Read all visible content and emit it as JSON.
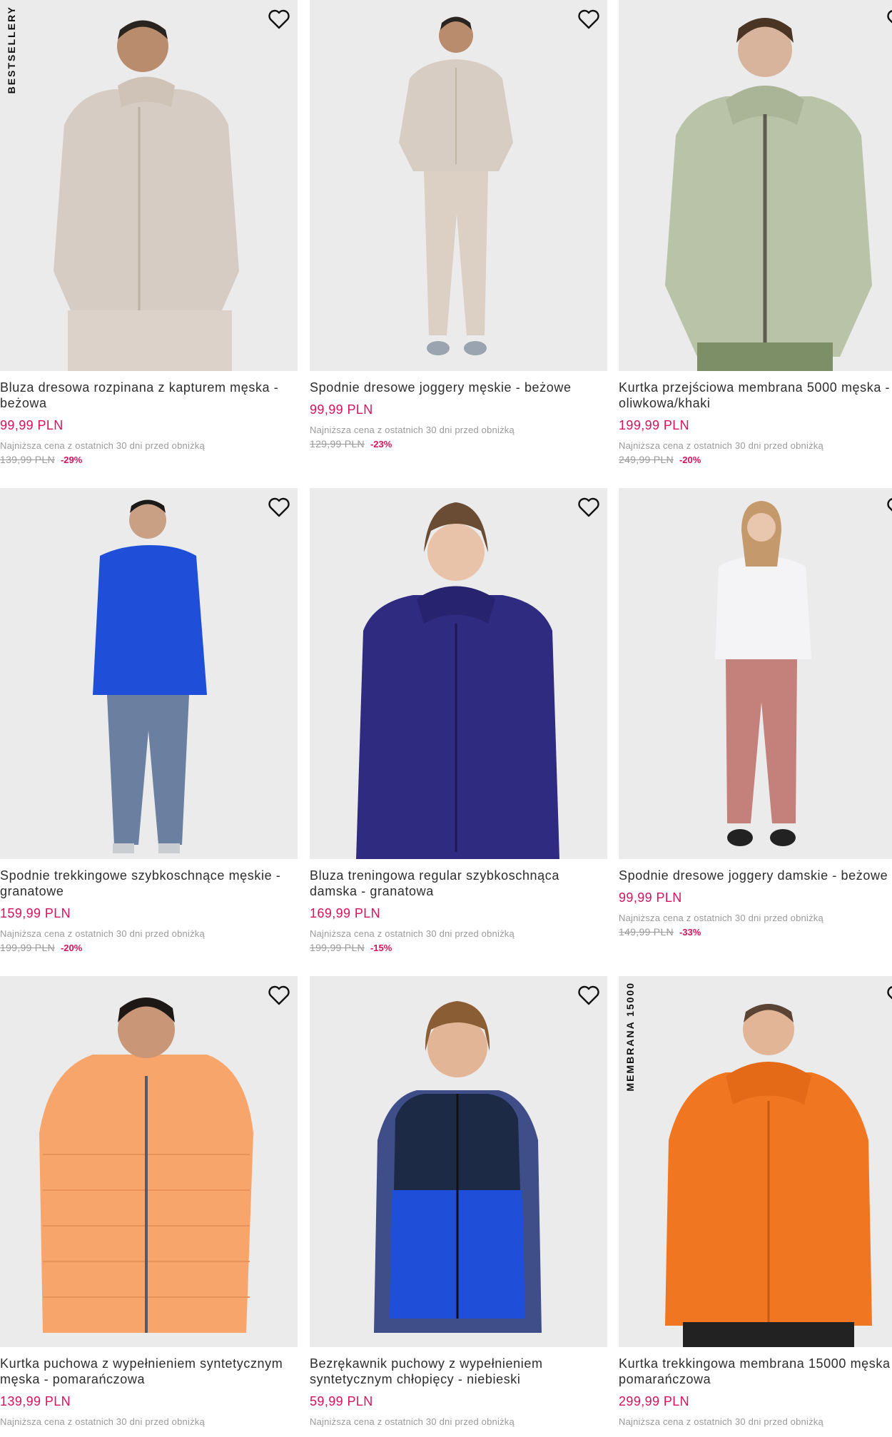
{
  "products": [
    {
      "badge": "BESTSELLERY",
      "name": "Bluza dresowa rozpinana z kapturem męska - beżowa",
      "price": "99,99 PLN",
      "lowest_note": "Najniższa cena z ostatnich 30 dni przed obniżką",
      "old_price": "139,99 PLN",
      "discount": "-29%",
      "image": "beige-zip-hoodie-man"
    },
    {
      "badge": "",
      "name": "Spodnie dresowe joggery męskie - beżowe",
      "price": "99,99 PLN",
      "lowest_note": "Najniższa cena z ostatnich 30 dni przed obniżką",
      "old_price": "129,99 PLN",
      "discount": "-23%",
      "image": "beige-joggers-man"
    },
    {
      "badge": "",
      "name": "Kurtka przejściowa membrana 5000 męska - oliwkowa/khaki",
      "price": "199,99 PLN",
      "lowest_note": "Najniższa cena z ostatnich 30 dni przed obniżką",
      "old_price": "249,99 PLN",
      "discount": "-20%",
      "image": "olive-jacket-man"
    },
    {
      "badge": "",
      "name": "Spodnie trekkingowe szybkoschnące męskie - granatowe",
      "price": "159,99 PLN",
      "lowest_note": "Najniższa cena z ostatnich 30 dni przed obniżką",
      "old_price": "199,99 PLN",
      "discount": "-20%",
      "image": "navy-trekking-pants-man"
    },
    {
      "badge": "",
      "name": "Bluza treningowa regular szybkoschnąca damska - granatowa",
      "price": "169,99 PLN",
      "lowest_note": "Najniższa cena z ostatnich 30 dni przed obniżką",
      "old_price": "199,99 PLN",
      "discount": "-15%",
      "image": "navy-training-hoodie-woman"
    },
    {
      "badge": "",
      "name": "Spodnie dresowe joggery damskie - beżowe",
      "price": "99,99 PLN",
      "lowest_note": "Najniższa cena z ostatnich 30 dni przed obniżką",
      "old_price": "149,99 PLN",
      "discount": "-33%",
      "image": "pink-joggers-woman"
    },
    {
      "badge": "",
      "name": "Kurtka puchowa z wypełnieniem syntetycznym męska - pomarańczowa",
      "price": "139,99 PLN",
      "lowest_note": "Najniższa cena z ostatnich 30 dni przed obniżką",
      "old_price": "",
      "discount": "",
      "image": "orange-puffer-man"
    },
    {
      "badge": "",
      "name": "Bezrękawnik puchowy z wypełnieniem syntetycznym chłopięcy - niebieski",
      "price": "59,99 PLN",
      "lowest_note": "Najniższa cena z ostatnich 30 dni przed obniżką",
      "old_price": "",
      "discount": "",
      "image": "blue-vest-boy"
    },
    {
      "badge": "MEMBRANA 15000",
      "name": "Kurtka trekkingowa membrana 15000 męska - pomarańczowa",
      "price": "299,99 PLN",
      "lowest_note": "Najniższa cena z ostatnich 30 dni przed obniżką",
      "old_price": "",
      "discount": "",
      "image": "orange-trekking-jacket-man"
    }
  ],
  "icons": {
    "favorite": "heart-outline-icon"
  },
  "colors": {
    "price": "#d6125f",
    "muted": "#9a9a9a",
    "image_bg": "#ececec"
  }
}
